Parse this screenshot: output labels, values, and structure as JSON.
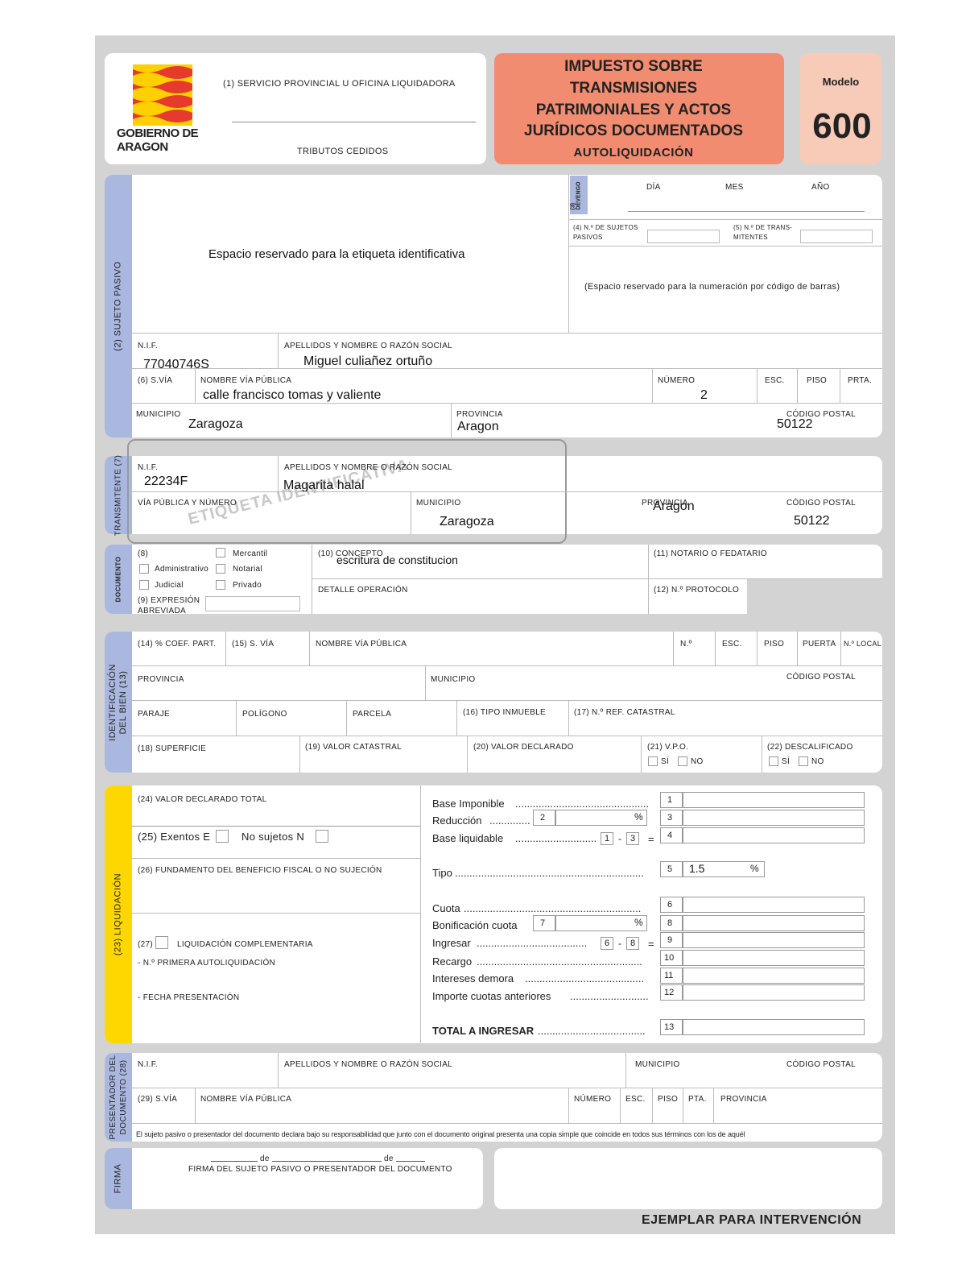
{
  "header": {
    "logo_text": "GOBIERNO DE ARAGON",
    "service_label": "(1) SERVICIO PROVINCIAL U OFICINA LIQUIDADORA",
    "tributos": "TRIBUTOS CEDIDOS",
    "title_l1": "IMPUESTO SOBRE",
    "title_l2": "TRANSMISIONES",
    "title_l3": "PATRIMONIALES  Y ACTOS",
    "title_l4": "JURÍDICOS DOCUMENTADOS",
    "title_sub": "AUTOLIQUIDACIÓN",
    "modelo_label": "Modelo",
    "modelo_num": "600",
    "colors": {
      "title_bg": "#f28c71",
      "modelo_bg": "#f8cbb9",
      "blue": "#aab8e0",
      "yellow": "#ffd700",
      "frame": "#d3d3d3"
    }
  },
  "sujeto": {
    "side": "(2) SUJETO PASIVO",
    "reserved": "Espacio reservado para la etiqueta identificativa",
    "devengo": "(3) DEVENGO",
    "dia": "DÍA",
    "mes": "MES",
    "anio": "AÑO",
    "n_sujetos": "(4) N.º DE SUJETOS PASIVOS",
    "n_trans": "(5) N.º DE TRANS- MITENTES",
    "barcode": "(Espacio reservado para la numeración por código de barras)",
    "nif_label": "N.I.F.",
    "nif": "77040746S",
    "nombre_label": "APELLIDOS Y NOMBRE O RAZÓN SOCIAL",
    "nombre": "Miguel culiañez ortuño",
    "svia_label": "(6) S.VÍA",
    "via_label": "NOMBRE VÍA PÚBLICA",
    "via": "calle francisco tomas y valiente",
    "numero_label": "NÚMERO",
    "numero": "2",
    "esc": "ESC.",
    "piso": "PISO",
    "prta": "PRTA.",
    "municipio_label": "MUNICIPIO",
    "municipio": "Zaragoza",
    "provincia_label": "PROVINCIA",
    "provincia": "Aragon",
    "cp_label": "CÓDIGO POSTAL",
    "cp": "50122"
  },
  "transmitente": {
    "side": "TRANSMITENTE (7)",
    "nif_label": "N.I.F.",
    "nif": "22234F",
    "nombre_label": "APELLIDOS Y NOMBRE O RAZÓN SOCIAL",
    "nombre": "Magarita halal",
    "via_label": "VÍA PÚBLICA Y NÚMERO",
    "municipio_label": "MUNICIPIO",
    "municipio": "Zaragoza",
    "provincia_label": "PROVINCIA",
    "provincia": "Aragon",
    "cp_label": "CÓDIGO POSTAL",
    "cp": "50122",
    "watermark": "ETIQUETA IDENTIFICATIVA"
  },
  "documento": {
    "side": "DOCUMENTO",
    "n8": "(8)",
    "mercantil": "Mercantil",
    "administrativo": "Administrativo",
    "notarial": "Notarial",
    "judicial": "Judicial",
    "privado": "Privado",
    "expresion": "(9) EXPRESIÓN ABREVIADA",
    "concepto_label": "(10) CONCEPTO",
    "concepto": "escritura de constitucion",
    "detalle": "DETALLE OPERACIÓN",
    "notario": "(11) NOTARIO O FEDATARIO",
    "protocolo": "(12) N.º PROTOCOLO"
  },
  "bien": {
    "side": "IDENTIFICACIÓN DEL BIEN (13)",
    "coef": "(14) % COEF. PART.",
    "svia": "(15) S. VÍA",
    "via": "NOMBRE VÍA PÚBLICA",
    "n": "N.º",
    "esc": "ESC.",
    "piso": "PISO",
    "puerta": "PUERTA",
    "local": "N.º LOCAL",
    "provincia": "PROVINCIA",
    "municipio": "MUNICIPIO",
    "cp": "CÓDIGO POSTAL",
    "paraje": "PARAJE",
    "poligono": "POLÍGONO",
    "parcela": "PARCELA",
    "tipo": "(16) TIPO INMUEBLE",
    "refcat": "(17) N.º REF. CATASTRAL",
    "superficie": "(18) SUPERFICIE",
    "valcat": "(19) VALOR CATASTRAL",
    "valdec": "(20) VALOR DECLARADO",
    "vpo": "(21) V.P.O.",
    "descal": "(22) DESCALIFICADO",
    "si": "SÍ",
    "no": "NO"
  },
  "liquidacion": {
    "side": "(23) LIQUIDACIÓN",
    "valor_total": "(24) VALOR DECLARADO TOTAL",
    "exentos": "(25) Exentos E",
    "no_sujetos": "No sujetos N",
    "fundamento": "(26) FUNDAMENTO DEL BENEFICIO FISCAL O NO SUJECIÓN",
    "complementaria": "LIQUIDACIÓN COMPLEMENTARIA",
    "n27": "(27)",
    "primera": "- N.º PRIMERA AUTOLIQUIDACIÓN",
    "fecha": "- FECHA PRESENTACIÓN",
    "base_imponible": "Base Imponible",
    "reduccion": "Reducción",
    "base_liquidable": "Base liquidable",
    "tipo": "Tipo",
    "tipo_val": "1.5",
    "pct": "%",
    "cuota": "Cuota",
    "bonificacion": "Bonificación cuota",
    "ingresar": "Ingresar",
    "recargo": "Recargo",
    "intereses": "Intereses demora",
    "importe": "Importe cuotas anteriores",
    "total": "TOTAL A INGRESAR",
    "n": [
      "1",
      "2",
      "3",
      "4",
      "5",
      "6",
      "7",
      "8",
      "9",
      "10",
      "11",
      "12",
      "13"
    ],
    "minus": "-",
    "eq": "="
  },
  "presentador": {
    "side": "PRESENTADOR DEL DOCUMENTO (28)",
    "nif": "N.I.F.",
    "nombre": "APELLIDOS Y NOMBRE O RAZÓN SOCIAL",
    "municipio": "MUNICIPIO",
    "cp": "CÓDIGO POSTAL",
    "svia": "(29) S.VÍA",
    "via": "NOMBRE VÍA PÚBLICA",
    "numero": "NÚMERO",
    "esc": "ESC.",
    "piso": "PISO",
    "pta": "PTA.",
    "provincia": "PROVINCIA",
    "declaracion": "El sujeto pasivo o presentador del documento declara bajo su responsabilidad que junto con el documento original presenta una copia simple que coincide en todos sus términos con los de aquél"
  },
  "firma": {
    "side": "FIRMA",
    "de1": "de",
    "de2": "de",
    "caption": "FIRMA DEL SUJETO PASIVO O PRESENTADOR DEL DOCUMENTO"
  },
  "footer": "EJEMPLAR PARA INTERVENCIÓN"
}
